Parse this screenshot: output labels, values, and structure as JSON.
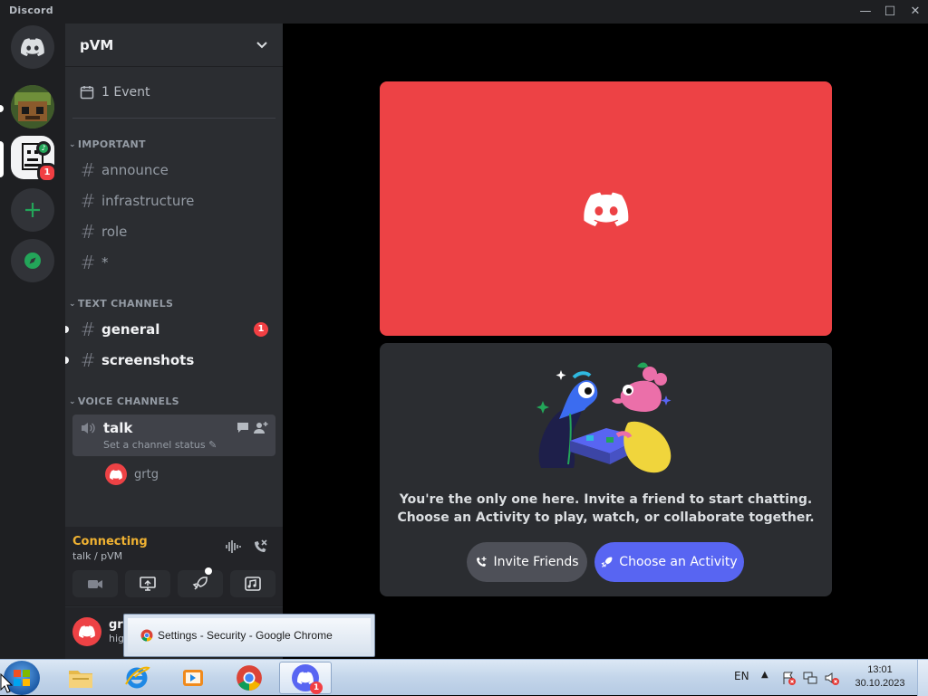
{
  "window": {
    "title": "Discord",
    "controls": {
      "minimize": "—",
      "maximize": "☐",
      "close": "✕"
    }
  },
  "servers": [
    {
      "name": "home",
      "icon": "discord-logo-icon"
    },
    {
      "name": "server-avatar-1",
      "icon": "pixel-avatar-icon"
    },
    {
      "name": "server-pvm",
      "icon": "pixel-face-icon",
      "badge": "1"
    },
    {
      "name": "add-server",
      "icon": "plus-icon"
    },
    {
      "name": "explore",
      "icon": "compass-icon"
    }
  ],
  "guild": {
    "name": "pVM",
    "events_label": "1 Event",
    "categories": [
      {
        "name": "IMPORTANT",
        "channels": [
          "announce",
          "infrastructure",
          "role",
          "*"
        ]
      },
      {
        "name": "TEXT CHANNELS",
        "channels": [
          {
            "name": "general",
            "badge": "1"
          },
          {
            "name": "screenshots"
          }
        ]
      },
      {
        "name": "VOICE CHANNELS",
        "voice": {
          "name": "talk",
          "status_placeholder": "Set a channel status",
          "members": [
            "grtg"
          ]
        }
      }
    ]
  },
  "voice_connection": {
    "status": "Connecting",
    "location": "talk / pVM"
  },
  "user_panel": {
    "name": "grt",
    "status": "hig"
  },
  "main": {
    "invite_line1": "You're the only one here. Invite a friend to start chatting.",
    "invite_line2": "Choose an Activity to play, watch, or collaborate together.",
    "invite_button": "Invite Friends",
    "activity_button": "Choose an Activity"
  },
  "tooltip": {
    "text": "Settings - Security - Google Chrome"
  },
  "taskbar": {
    "language": "EN",
    "time": "13:01",
    "date": "30.10.2023",
    "discord_badge": "1"
  },
  "colors": {
    "blurple": "#5865f2",
    "red": "#ed4245",
    "connecting": "#f0b232"
  }
}
